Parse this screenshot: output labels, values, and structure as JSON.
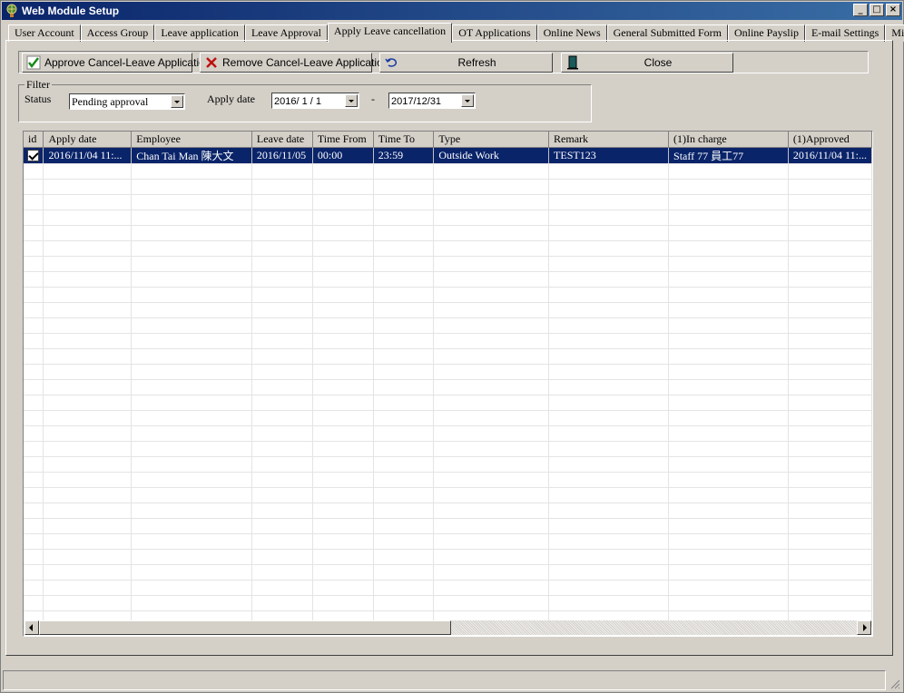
{
  "window": {
    "title": "Web Module Setup",
    "controls": {
      "minimize": "_",
      "maximize": "□",
      "close": "×"
    }
  },
  "tabs": [
    {
      "label": "User Account"
    },
    {
      "label": "Access Group"
    },
    {
      "label": "Leave application"
    },
    {
      "label": "Leave Approval"
    },
    {
      "label": "Apply Leave cancellation",
      "active": true
    },
    {
      "label": "OT Applications"
    },
    {
      "label": "Online News"
    },
    {
      "label": "General Submitted Form"
    },
    {
      "label": "Online Payslip"
    },
    {
      "label": "E-mail Settings"
    },
    {
      "label": "Misc."
    }
  ],
  "toolbar": {
    "approve_label": "Approve Cancel-Leave Application",
    "remove_label": "Remove Cancel-Leave Application",
    "refresh_label": "Refresh",
    "close_label": "Close"
  },
  "filter": {
    "legend": "Filter",
    "status_label": "Status",
    "status_value": "Pending approval",
    "apply_date_label": "Apply date",
    "date_from": "2016/ 1 / 1",
    "date_sep": "-",
    "date_to": "2017/12/31"
  },
  "grid": {
    "columns": [
      "id",
      "Apply date",
      "Employee",
      "Leave date",
      "Time From",
      "Time To",
      "Type",
      "Remark",
      "(1)In charge",
      "(1)Approved"
    ],
    "rows": [
      {
        "checked": true,
        "apply_date": "2016/11/04 11:...",
        "employee": "Chan Tai Man 陳大文",
        "leave_date": "2016/11/05",
        "time_from": "00:00",
        "time_to": "23:59",
        "type": "Outside Work",
        "remark": "TEST123",
        "in_charge": "Staff 77 員工77",
        "approved": "2016/11/04 11:..."
      }
    ]
  },
  "icons": {
    "approve": "green-check-icon",
    "remove": "red-x-icon",
    "refresh": "undo-arrow-icon",
    "close": "door-exit-icon"
  },
  "colors": {
    "selection": "#0a246a",
    "face": "#d4d0c8"
  }
}
